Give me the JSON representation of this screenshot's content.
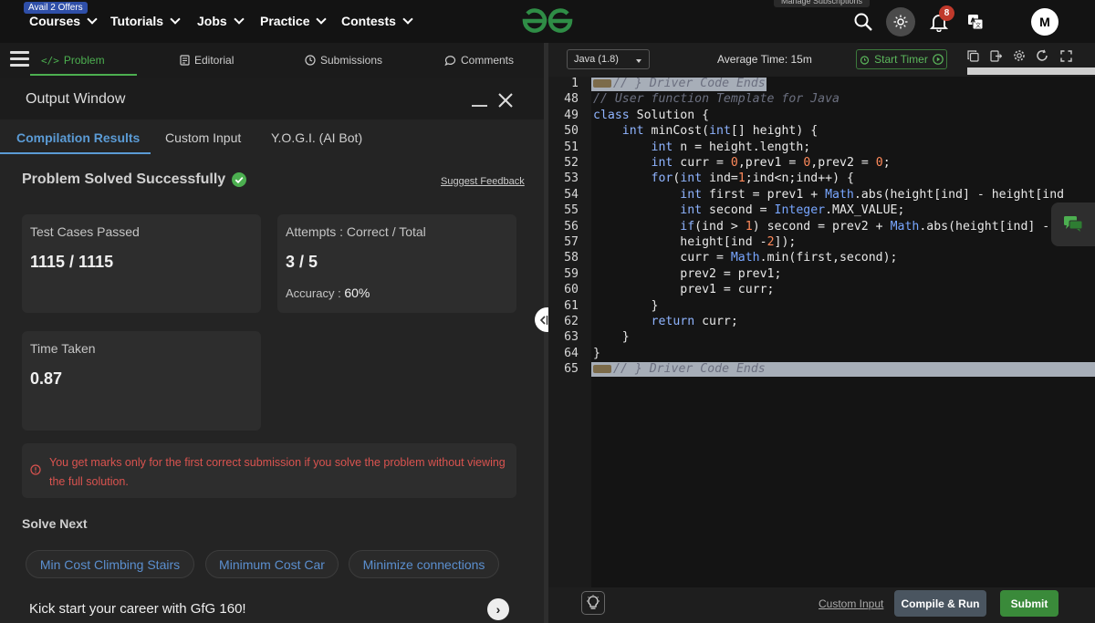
{
  "topnav": {
    "offer_badge": "Avail 2 Offers",
    "items": [
      "Courses",
      "Tutorials",
      "Jobs",
      "Practice",
      "Contests"
    ],
    "manage_subscriptions": "Manage Subscriptions",
    "notification_count": "8",
    "avatar_initial": "M"
  },
  "problem_tabs": {
    "problem": "Problem",
    "editorial": "Editorial",
    "submissions": "Submissions",
    "comments": "Comments"
  },
  "output_window": {
    "title": "Output Window",
    "tabs": [
      "Compilation Results",
      "Custom Input",
      "Y.O.G.I. (AI Bot)"
    ],
    "status": "Problem Solved Successfully",
    "suggest_feedback": "Suggest Feedback",
    "test_cases": {
      "label": "Test Cases Passed",
      "value": "1115 / 1115"
    },
    "attempts": {
      "label": "Attempts : Correct / Total",
      "value": "3 / 5",
      "accuracy_label": "Accuracy :",
      "accuracy_value": "60%"
    },
    "time_taken": {
      "label": "Time Taken",
      "value": "0.87"
    },
    "warning": "You get marks only for the first correct submission if you solve the problem without viewing the full solution.",
    "solve_next_title": "Solve Next",
    "solve_next": [
      "Min Cost Climbing Stairs",
      "Minimum Cost Car",
      "Minimize connections"
    ],
    "kickstart": "Kick start your career with GfG 160!"
  },
  "editor": {
    "language": "Java (1.8)",
    "average_time": "Average Time: 15m",
    "start_timer": "Start Timer",
    "line_numbers": [
      "1",
      "48",
      "49",
      "50",
      "51",
      "52",
      "53",
      "54",
      "55",
      "56",
      "57",
      "58",
      "59",
      "60",
      "61",
      "62",
      "63",
      "64",
      "65"
    ],
    "custom_input": "Custom Input",
    "compile_run": "Compile & Run",
    "submit": "Submit"
  },
  "colors": {
    "accent_green": "#4caf50",
    "accent_blue": "#5b9bd5",
    "warning_red": "#d9534f"
  }
}
